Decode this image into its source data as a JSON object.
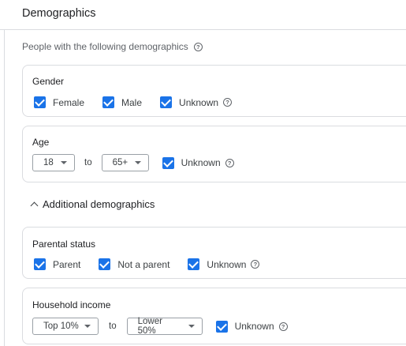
{
  "header": {
    "title": "Demographics"
  },
  "intro": {
    "text": "People with the following demographics"
  },
  "gender": {
    "label": "Gender",
    "options": [
      {
        "label": "Female",
        "checked": true
      },
      {
        "label": "Male",
        "checked": true
      },
      {
        "label": "Unknown",
        "checked": true
      }
    ]
  },
  "age": {
    "label": "Age",
    "from": "18",
    "to_text": "to",
    "to": "65+",
    "unknown_label": "Unknown",
    "unknown_checked": true
  },
  "additional": {
    "label": "Additional demographics",
    "expanded": true
  },
  "parental": {
    "label": "Parental status",
    "options": [
      {
        "label": "Parent",
        "checked": true
      },
      {
        "label": "Not a parent",
        "checked": true
      },
      {
        "label": "Unknown",
        "checked": true
      }
    ]
  },
  "income": {
    "label": "Household income",
    "from": "Top 10%",
    "to_text": "to",
    "to": "Lower 50%",
    "unknown_label": "Unknown",
    "unknown_checked": true
  },
  "colors": {
    "accent": "#1a73e8",
    "border": "#dadce0",
    "text": "#202124",
    "muted": "#5f6368"
  },
  "icons": {
    "help": "help-circle-icon",
    "check": "checkbox-checked-icon",
    "dropdown": "caret-down-icon",
    "collapse": "chevron-up-icon"
  }
}
